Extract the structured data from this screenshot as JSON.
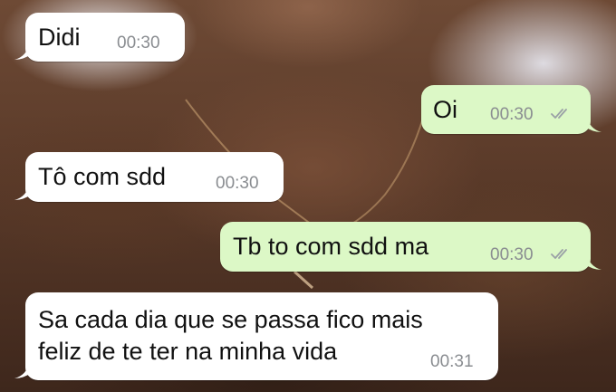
{
  "conversation": {
    "messages": [
      {
        "direction": "incoming",
        "lines": [
          "Didi"
        ],
        "time": "00:30"
      },
      {
        "direction": "outgoing",
        "lines": [
          "Oi"
        ],
        "time": "00:30",
        "status_icon": "double-check-icon"
      },
      {
        "direction": "incoming",
        "lines": [
          "Tô com sdd"
        ],
        "time": "00:30"
      },
      {
        "direction": "outgoing",
        "lines": [
          "Tb to com sdd ma"
        ],
        "time": "00:30",
        "status_icon": "double-check-icon"
      },
      {
        "direction": "incoming",
        "lines": [
          "Sa cada dia que se passa fico mais",
          "feliz de te ter na minha vida"
        ],
        "time": "00:31"
      }
    ]
  },
  "colors": {
    "incoming_bubble": "#ffffff",
    "outgoing_bubble": "#dcf8c6",
    "timestamp": "#8a8d91",
    "read_ticks": "#9aa0a6"
  }
}
